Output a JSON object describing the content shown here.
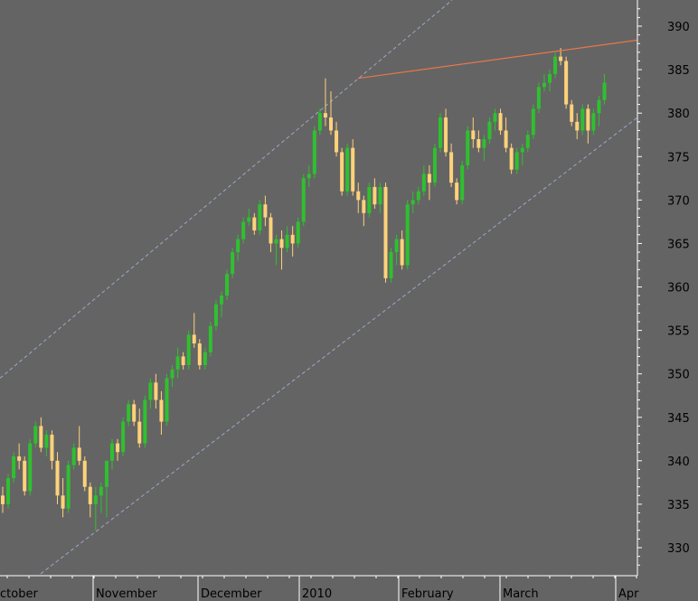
{
  "chart_data": {
    "type": "candlestick",
    "y_ticks": [
      330,
      335,
      340,
      345,
      350,
      355,
      360,
      365,
      370,
      375,
      380,
      385,
      390
    ],
    "ylim": [
      326,
      393
    ],
    "x_labels": [
      "ctober",
      "November",
      "December",
      "2010",
      "February",
      "March",
      "Apr"
    ],
    "grid": false,
    "colors": {
      "background": "#646464",
      "up": "#2fc02f",
      "down": "#ffd27a",
      "trendline": "#e8774b",
      "channel": "#a6b3d9",
      "axis": "#ffffff",
      "text": "#000000"
    },
    "candles": [
      [
        336.0,
        337.0,
        334.0,
        335.0
      ],
      [
        335.0,
        338.5,
        334.5,
        338.0
      ],
      [
        338.0,
        341.0,
        337.5,
        340.5
      ],
      [
        340.5,
        342.0,
        339.0,
        340.0
      ],
      [
        340.0,
        340.5,
        336.0,
        336.5
      ],
      [
        336.5,
        342.5,
        336.0,
        342.0
      ],
      [
        342.0,
        344.5,
        341.5,
        344.0
      ],
      [
        344.0,
        345.0,
        341.0,
        341.5
      ],
      [
        341.5,
        343.5,
        340.5,
        343.0
      ],
      [
        343.0,
        343.5,
        339.0,
        340.0
      ],
      [
        340.0,
        341.0,
        335.0,
        336.0
      ],
      [
        336.0,
        338.0,
        333.5,
        334.5
      ],
      [
        334.5,
        340.0,
        334.0,
        339.5
      ],
      [
        339.5,
        342.0,
        339.0,
        341.5
      ],
      [
        341.5,
        344.0,
        339.5,
        340.0
      ],
      [
        340.0,
        340.5,
        336.5,
        337.0
      ],
      [
        337.0,
        337.5,
        333.5,
        335.0
      ],
      [
        335.0,
        337.0,
        332.0,
        336.0
      ],
      [
        336.0,
        337.5,
        334.0,
        337.0
      ],
      [
        337.0,
        340.0,
        333.5,
        340.0
      ],
      [
        340.0,
        342.5,
        339.0,
        342.0
      ],
      [
        342.0,
        342.5,
        340.0,
        341.0
      ],
      [
        341.0,
        345.0,
        340.5,
        344.5
      ],
      [
        344.5,
        347.0,
        344.0,
        346.5
      ],
      [
        346.5,
        347.0,
        344.0,
        344.5
      ],
      [
        344.5,
        346.0,
        341.5,
        342.0
      ],
      [
        342.0,
        347.5,
        341.5,
        347.0
      ],
      [
        347.0,
        349.5,
        346.0,
        349.0
      ],
      [
        349.0,
        350.0,
        346.0,
        347.0
      ],
      [
        347.0,
        348.0,
        343.0,
        344.5
      ],
      [
        344.5,
        350.0,
        344.0,
        349.5
      ],
      [
        349.5,
        351.0,
        348.5,
        350.5
      ],
      [
        350.5,
        353.0,
        349.5,
        352.0
      ],
      [
        352.0,
        352.5,
        350.5,
        351.0
      ],
      [
        351.0,
        355.0,
        350.5,
        354.5
      ],
      [
        354.5,
        357.0,
        353.0,
        353.5
      ],
      [
        353.5,
        354.0,
        350.5,
        351.0
      ],
      [
        351.0,
        353.0,
        350.5,
        352.5
      ],
      [
        352.5,
        356.0,
        352.0,
        355.5
      ],
      [
        355.5,
        358.5,
        355.0,
        358.0
      ],
      [
        358.0,
        359.5,
        356.5,
        359.0
      ],
      [
        359.0,
        362.0,
        358.5,
        361.5
      ],
      [
        361.5,
        364.5,
        361.0,
        364.0
      ],
      [
        364.0,
        366.0,
        363.0,
        365.5
      ],
      [
        365.5,
        368.0,
        365.0,
        367.5
      ],
      [
        367.5,
        369.0,
        367.0,
        368.0
      ],
      [
        368.0,
        368.5,
        366.0,
        366.5
      ],
      [
        366.5,
        370.0,
        366.0,
        369.5
      ],
      [
        369.5,
        370.5,
        367.0,
        368.0
      ],
      [
        368.0,
        368.5,
        364.0,
        365.0
      ],
      [
        365.0,
        366.0,
        362.5,
        365.5
      ],
      [
        365.5,
        366.5,
        362.0,
        364.5
      ],
      [
        364.5,
        367.0,
        364.0,
        366.0
      ],
      [
        366.0,
        367.0,
        363.5,
        365.0
      ],
      [
        365.0,
        368.0,
        364.5,
        367.5
      ],
      [
        367.5,
        373.0,
        367.0,
        372.5
      ],
      [
        372.5,
        374.0,
        371.5,
        373.0
      ],
      [
        373.0,
        378.5,
        372.5,
        378.0
      ],
      [
        378.0,
        380.5,
        377.5,
        380.0
      ],
      [
        380.0,
        384.0,
        378.5,
        379.5
      ],
      [
        379.5,
        382.5,
        377.5,
        378.0
      ],
      [
        378.0,
        379.0,
        375.0,
        375.5
      ],
      [
        375.5,
        376.0,
        370.5,
        371.0
      ],
      [
        371.0,
        376.5,
        370.5,
        376.0
      ],
      [
        376.0,
        377.0,
        370.5,
        371.0
      ],
      [
        371.0,
        372.0,
        368.5,
        370.0
      ],
      [
        370.0,
        370.5,
        367.0,
        368.5
      ],
      [
        368.5,
        372.0,
        368.0,
        371.5
      ],
      [
        371.5,
        372.5,
        369.0,
        369.5
      ],
      [
        369.5,
        372.0,
        368.5,
        371.5
      ],
      [
        371.5,
        372.0,
        360.5,
        361.0
      ],
      [
        361.0,
        364.5,
        360.5,
        364.0
      ],
      [
        364.0,
        366.0,
        362.5,
        365.5
      ],
      [
        365.5,
        366.5,
        362.0,
        362.5
      ],
      [
        362.5,
        370.0,
        362.0,
        369.5
      ],
      [
        369.5,
        371.0,
        368.5,
        370.0
      ],
      [
        370.0,
        371.5,
        369.5,
        371.0
      ],
      [
        371.0,
        374.0,
        370.5,
        373.0
      ],
      [
        373.0,
        374.0,
        370.0,
        372.0
      ],
      [
        372.0,
        376.5,
        371.5,
        376.0
      ],
      [
        376.0,
        380.0,
        375.5,
        379.5
      ],
      [
        379.5,
        380.5,
        375.0,
        375.5
      ],
      [
        375.5,
        376.5,
        371.5,
        372.0
      ],
      [
        372.0,
        372.5,
        369.5,
        370.0
      ],
      [
        370.0,
        374.5,
        369.5,
        374.0
      ],
      [
        374.0,
        378.5,
        373.5,
        378.0
      ],
      [
        378.0,
        379.5,
        376.0,
        377.0
      ],
      [
        377.0,
        378.0,
        375.5,
        376.0
      ],
      [
        376.0,
        377.5,
        374.5,
        377.0
      ],
      [
        377.0,
        379.5,
        376.5,
        379.0
      ],
      [
        379.0,
        380.5,
        378.0,
        380.0
      ],
      [
        380.0,
        380.5,
        377.5,
        378.0
      ],
      [
        378.0,
        379.5,
        375.5,
        376.0
      ],
      [
        376.0,
        376.5,
        373.0,
        373.5
      ],
      [
        373.5,
        376.0,
        373.0,
        375.5
      ],
      [
        375.5,
        376.5,
        374.0,
        376.0
      ],
      [
        376.0,
        378.0,
        375.5,
        377.5
      ],
      [
        377.5,
        381.0,
        377.0,
        380.5
      ],
      [
        380.5,
        383.5,
        380.0,
        383.0
      ],
      [
        383.0,
        384.5,
        382.5,
        383.5
      ],
      [
        383.5,
        385.0,
        382.5,
        384.5
      ],
      [
        384.5,
        387.0,
        384.0,
        386.5
      ],
      [
        386.5,
        387.5,
        385.5,
        386.0
      ],
      [
        386.0,
        386.5,
        380.5,
        381.0
      ],
      [
        381.0,
        381.5,
        378.5,
        379.0
      ],
      [
        379.0,
        380.0,
        377.0,
        378.0
      ],
      [
        378.0,
        381.0,
        377.5,
        380.5
      ],
      [
        380.5,
        381.0,
        376.5,
        378.0
      ],
      [
        378.0,
        380.5,
        377.5,
        380.0
      ],
      [
        380.0,
        382.0,
        378.5,
        381.5
      ],
      [
        381.5,
        384.5,
        381.0,
        383.5
      ]
    ]
  }
}
